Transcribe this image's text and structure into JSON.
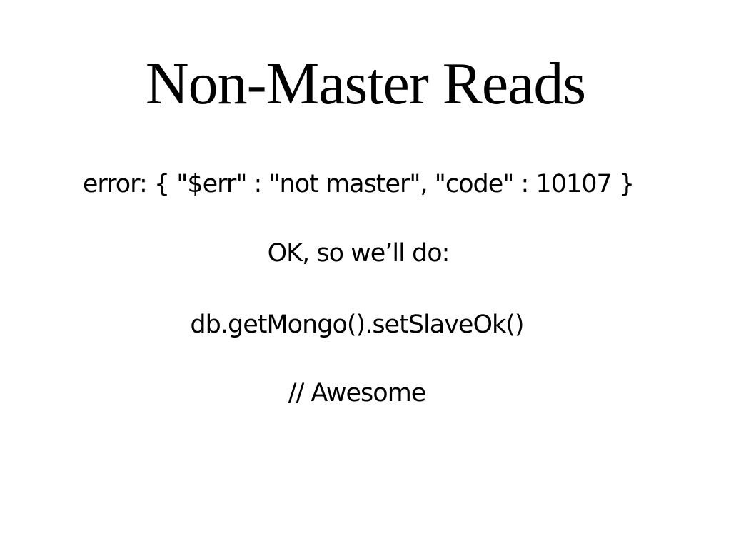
{
  "slide": {
    "title": "Non-Master Reads",
    "lines": [
      "error: { \"$err\" : \"not master\", \"code\" : 10107 }",
      "OK, so we’ll do:",
      "db.getMongo().setSlaveOk()",
      "// Awesome"
    ]
  }
}
